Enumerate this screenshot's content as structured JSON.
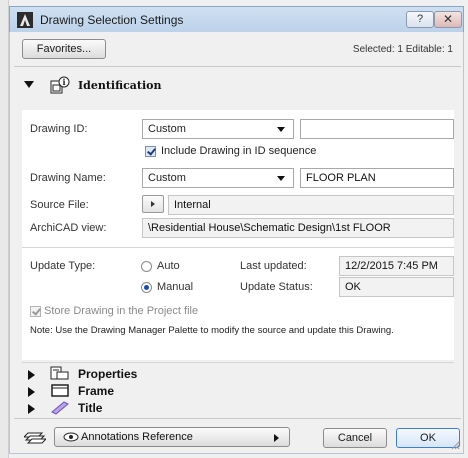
{
  "window": {
    "title": "Drawing Selection Settings",
    "help_label": "?",
    "close_label": "✕"
  },
  "toolbar": {
    "favorites_label": "Favorites...",
    "selected_text": "Selected: 1 Editable: 1"
  },
  "sections": {
    "identification": "Identification",
    "properties": "Properties",
    "frame": "Frame",
    "title": "Title"
  },
  "identification": {
    "drawing_id_label": "Drawing ID:",
    "drawing_id_mode": "Custom",
    "drawing_id_value": "",
    "include_label": "Include Drawing in ID sequence",
    "include_checked": true,
    "drawing_name_label": "Drawing Name:",
    "drawing_name_mode": "Custom",
    "drawing_name_value": "FLOOR PLAN",
    "source_file_label": "Source File:",
    "source_file_value": "Internal",
    "archicad_view_label": "ArchiCAD view:",
    "archicad_view_value": "\\Residential House\\Schematic Design\\1st FLOOR",
    "update_type_label": "Update Type:",
    "update_auto_label": "Auto",
    "update_manual_label": "Manual",
    "update_selected": "Manual",
    "last_updated_label": "Last updated:",
    "last_updated_value": "12/2/2015 7:45 PM",
    "update_status_label": "Update Status:",
    "update_status_value": "OK",
    "store_label": "Store Drawing in the Project file",
    "store_checked": true,
    "note_text": "Note:   Use the Drawing Manager Palette to modify the source and update this Drawing."
  },
  "footer": {
    "annotations_label": "Annotations Reference",
    "cancel_label": "Cancel",
    "ok_label": "OK"
  },
  "icons": [
    "archicad-app-icon",
    "identification-icon",
    "properties-icon",
    "frame-icon",
    "title-icon",
    "layers-icon",
    "eye-icon",
    "resize-grip-icon"
  ],
  "colors": {
    "titlebar": "#c4d7ee",
    "ok_border": "#3c7fd2",
    "panel": "#ffffff",
    "background": "#f0f0f0"
  }
}
